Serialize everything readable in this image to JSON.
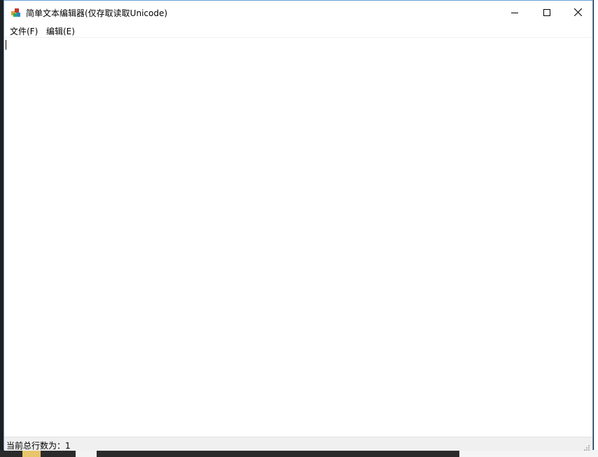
{
  "window": {
    "title": "简单文本编辑器(仅存取读取Unicode)",
    "icon": "app-icon"
  },
  "window_controls": {
    "minimize_icon": "minimize-icon",
    "maximize_icon": "maximize-icon",
    "close_icon": "close-icon"
  },
  "menubar": {
    "items": [
      {
        "label": "文件(F)"
      },
      {
        "label": "编辑(E)"
      }
    ]
  },
  "editor": {
    "content": ""
  },
  "statusbar": {
    "label": "当前总行数为：",
    "line_count": "1"
  },
  "colors": {
    "window_border": "#6aa0d8",
    "statusbar_bg": "#f0f0f0"
  }
}
